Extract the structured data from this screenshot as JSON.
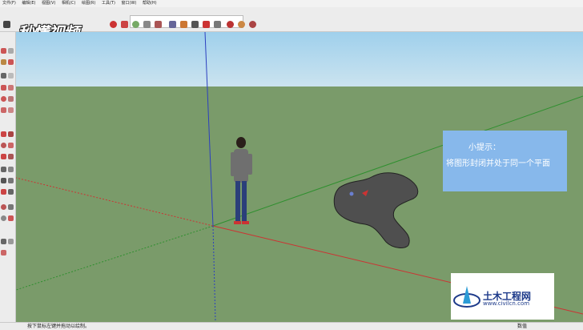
{
  "menu": [
    "文件(F)",
    "编辑(E)",
    "视图(V)",
    "相机(C)",
    "绘图(R)",
    "工具(T)",
    "窗口(W)",
    "帮助(H)"
  ],
  "logo": {
    "text": "秒懂视频"
  },
  "tip": {
    "title": "小提示：",
    "body": "将图形封闭并处于同一个平面"
  },
  "watermark": {
    "name": "土木工程网",
    "url": "www.civilcn.com"
  },
  "status": {
    "message": "按下鼠标左键并拖动以绘制。",
    "measure_label": "数值"
  },
  "colors": {
    "sky": "#9fd0ec",
    "ground": "#7a9b6a",
    "tip_bg": "#87b8eb",
    "shape": "#4f4f4f"
  }
}
